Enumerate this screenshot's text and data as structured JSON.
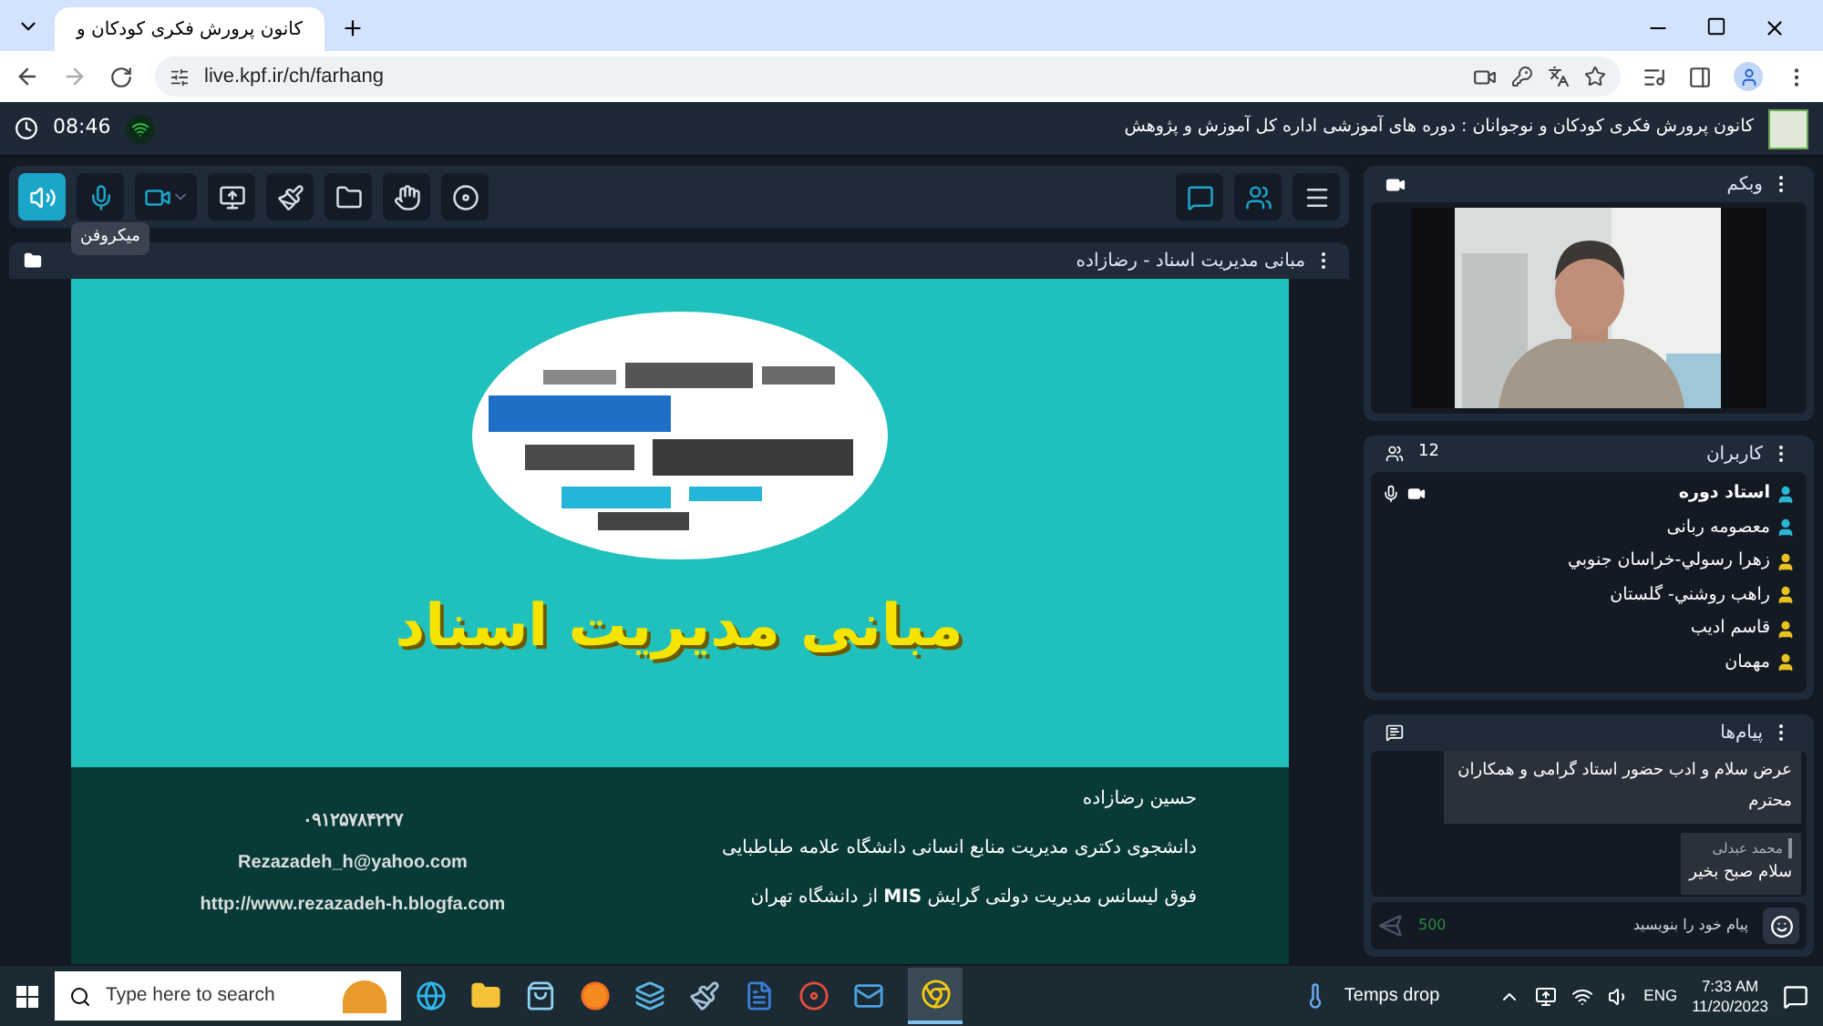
{
  "browser": {
    "tab_title": "کانون پرورش فکری کودکان و",
    "url": "live.kpf.ir/ch/farhang"
  },
  "header": {
    "title": "کانون پرورش فکری کودکان و نوجوانان : دوره های آموزشی اداره کل آموزش و پژوهش",
    "time": "08:46"
  },
  "toolbar": {
    "left": [
      {
        "kind": "filled"
      },
      {
        "kind": "accent"
      },
      {
        "kind": "accent"
      },
      {
        "kind": "plain"
      },
      {
        "kind": "plain"
      },
      {
        "kind": "plain"
      },
      {
        "kind": "plain"
      },
      {
        "kind": "plain"
      }
    ],
    "right": [
      {
        "kind": "accent"
      },
      {
        "kind": "accent"
      },
      {
        "kind": "plain"
      }
    ],
    "tooltip": "میکروفن"
  },
  "slide_panel": {
    "title": "مبانی مدیریت اسناد - رضازاده",
    "slide": {
      "title": "مبانی مدیریت اسناد",
      "author_lines": [
        "حسین رضازاده",
        "دانشجوی دکتری مدیریت منابع انسانی دانشگاه علامه طباطبایی",
        "فوق لیسانس مدیریت دولتی گرایش **MIS** از دانشگاه تهران"
      ],
      "contact_lines": [
        "۰۹۱۲۵۷۸۴۲۲۷",
        "Rezazadeh_h@yahoo.com",
        "http://www.rezazadeh-h.blogfa.com"
      ]
    }
  },
  "webcam": {
    "title": "وبکم"
  },
  "users": {
    "title": "کاربران",
    "count": "12",
    "items": [
      {
        "name": "استاد دوره",
        "color": "#2ab7d6",
        "media": true
      },
      {
        "name": "معصومه ربانی",
        "color": "#2ab7d6",
        "media": false
      },
      {
        "name": "زهرا رسولي-خراسان جنوبي",
        "color": "#e8c21e",
        "media": false
      },
      {
        "name": "راهب روشني- گلستان",
        "color": "#e8c21e",
        "media": false
      },
      {
        "name": "قاسم ادیب",
        "color": "#e8c21e",
        "media": false
      },
      {
        "name": "مهمان",
        "color": "#e8c21e",
        "media": false
      }
    ]
  },
  "messages": {
    "title": "پیام‌ها",
    "items": [
      {
        "text": "عرض سلام و ادب حضور استاد گرامی و همکاران محترم"
      },
      {
        "sender": "محمد عبدلی",
        "text": "سلام صبح بخیر"
      }
    ],
    "input": {
      "placeholder": "پیام خود را بنویسید",
      "counter": "500"
    }
  },
  "taskbar": {
    "search_placeholder": "Type here to search",
    "weather": "Temps drop",
    "language": "ENG",
    "time": "7:33 AM",
    "date": "11/20/2023"
  }
}
